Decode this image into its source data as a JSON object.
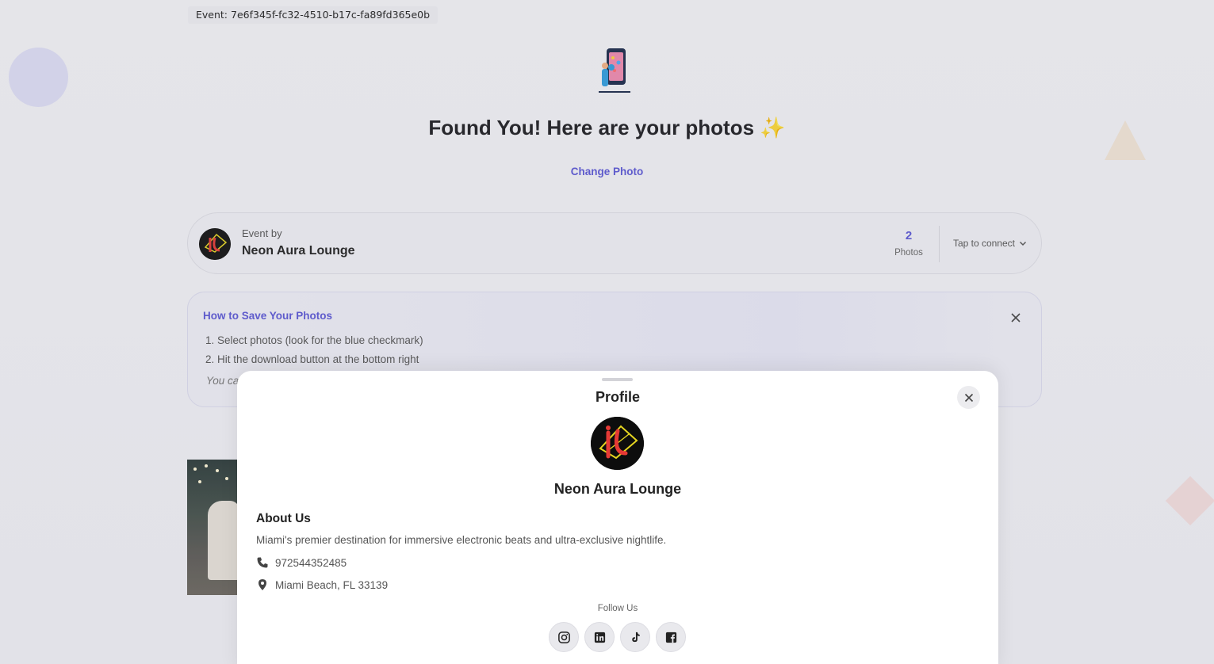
{
  "event": {
    "id_label": "Event: 7e6f345f-fc32-4510-b17c-fa89fd365e0b"
  },
  "hero": {
    "icon": "selfie-phone-icon",
    "heading": "Found You! Here are your photos ✨",
    "change_photo_label": "Change Photo"
  },
  "host_card": {
    "by_label": "Event by",
    "name": "Neon Aura Lounge",
    "photos_count": "2",
    "photos_label": "Photos",
    "connect_label": "Tap to connect"
  },
  "help": {
    "title": "How to Save Your Photos",
    "steps": [
      "1. Select photos (look for the blue checkmark)",
      "2. Hit the download button at the bottom right"
    ],
    "note": "You ca"
  },
  "profile_sheet": {
    "title": "Profile",
    "name": "Neon Aura Lounge",
    "about_title": "About Us",
    "about_text": "Miami's premier destination for immersive electronic beats and ultra-exclusive nightlife.",
    "phone": "972544352485",
    "location": "Miami Beach, FL 33139",
    "follow_label": "Follow Us",
    "socials": [
      "instagram-icon",
      "linkedin-icon",
      "tiktok-icon",
      "facebook-icon"
    ]
  },
  "colors": {
    "accent": "#5b57d6",
    "text": "#222222",
    "muted": "#555555"
  }
}
